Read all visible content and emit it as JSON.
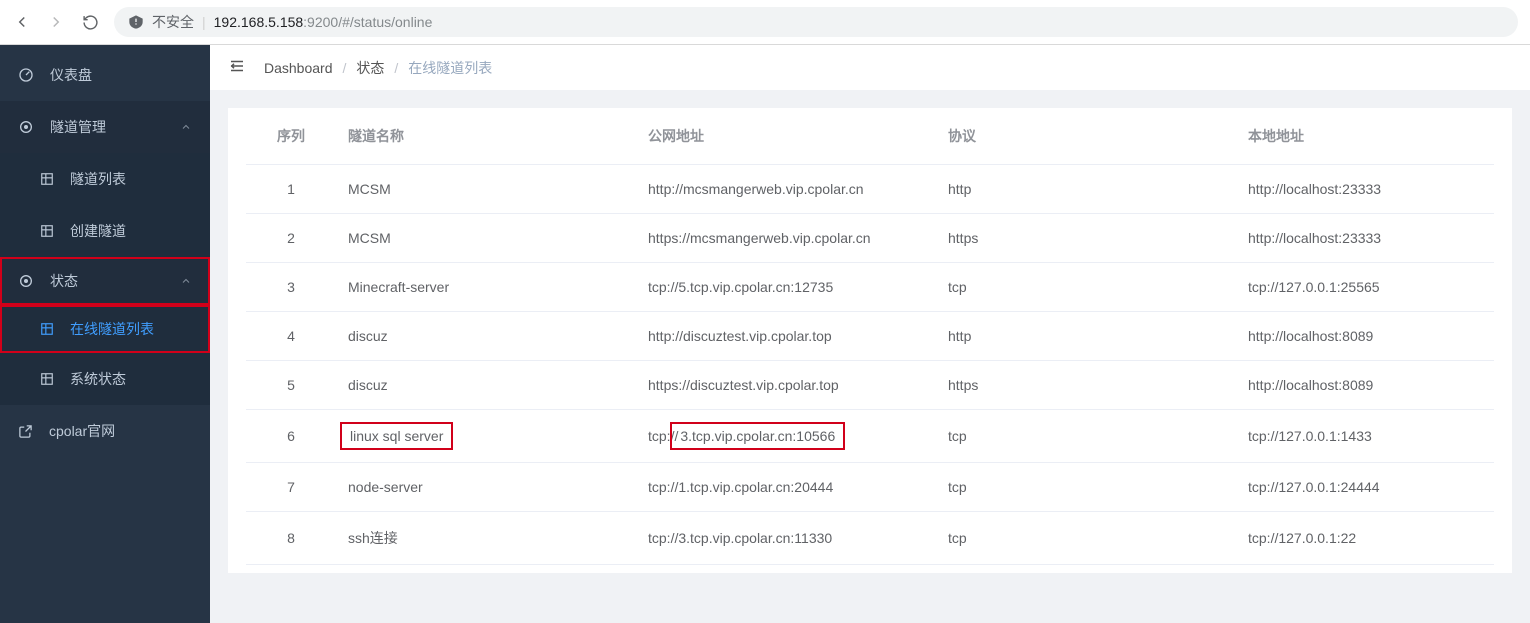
{
  "browser": {
    "insecure_label": "不安全",
    "url_ip": "192.168.5.158",
    "url_rest": ":9200/#/status/online"
  },
  "sidebar": {
    "items": [
      {
        "label": "仪表盘"
      },
      {
        "label": "隧道管理"
      },
      {
        "label": "隧道列表"
      },
      {
        "label": "创建隧道"
      },
      {
        "label": "状态"
      },
      {
        "label": "在线隧道列表"
      },
      {
        "label": "系统状态"
      },
      {
        "label": "cpolar官网"
      }
    ]
  },
  "breadcrumb": {
    "c0": "Dashboard",
    "c1": "状态",
    "c2": "在线隧道列表"
  },
  "table": {
    "headers": {
      "seq": "序列",
      "name": "隧道名称",
      "public": "公网地址",
      "proto": "协议",
      "local": "本地地址"
    },
    "rows": [
      {
        "seq": "1",
        "name": "MCSM",
        "public": "http://mcsmangerweb.vip.cpolar.cn",
        "proto": "http",
        "local": "http://localhost:23333"
      },
      {
        "seq": "2",
        "name": "MCSM",
        "public": "https://mcsmangerweb.vip.cpolar.cn",
        "proto": "https",
        "local": "http://localhost:23333"
      },
      {
        "seq": "3",
        "name": "Minecraft-server",
        "public": "tcp://5.tcp.vip.cpolar.cn:12735",
        "proto": "tcp",
        "local": "tcp://127.0.0.1:25565"
      },
      {
        "seq": "4",
        "name": "discuz",
        "public": "http://discuztest.vip.cpolar.top",
        "proto": "http",
        "local": "http://localhost:8089"
      },
      {
        "seq": "5",
        "name": "discuz",
        "public": "https://discuztest.vip.cpolar.top",
        "proto": "https",
        "local": "http://localhost:8089"
      },
      {
        "seq": "6",
        "name": "linux sql server",
        "public_pre": "tcp://",
        "public_hl": "3.tcp.vip.cpolar.cn:10566",
        "proto": "tcp",
        "local": "tcp://127.0.0.1:1433",
        "highlight": true
      },
      {
        "seq": "7",
        "name": "node-server",
        "public": "tcp://1.tcp.vip.cpolar.cn:20444",
        "proto": "tcp",
        "local": "tcp://127.0.0.1:24444"
      },
      {
        "seq": "8",
        "name": "ssh连接",
        "public": "tcp://3.tcp.vip.cpolar.cn:11330",
        "proto": "tcp",
        "local": "tcp://127.0.0.1:22"
      }
    ]
  }
}
